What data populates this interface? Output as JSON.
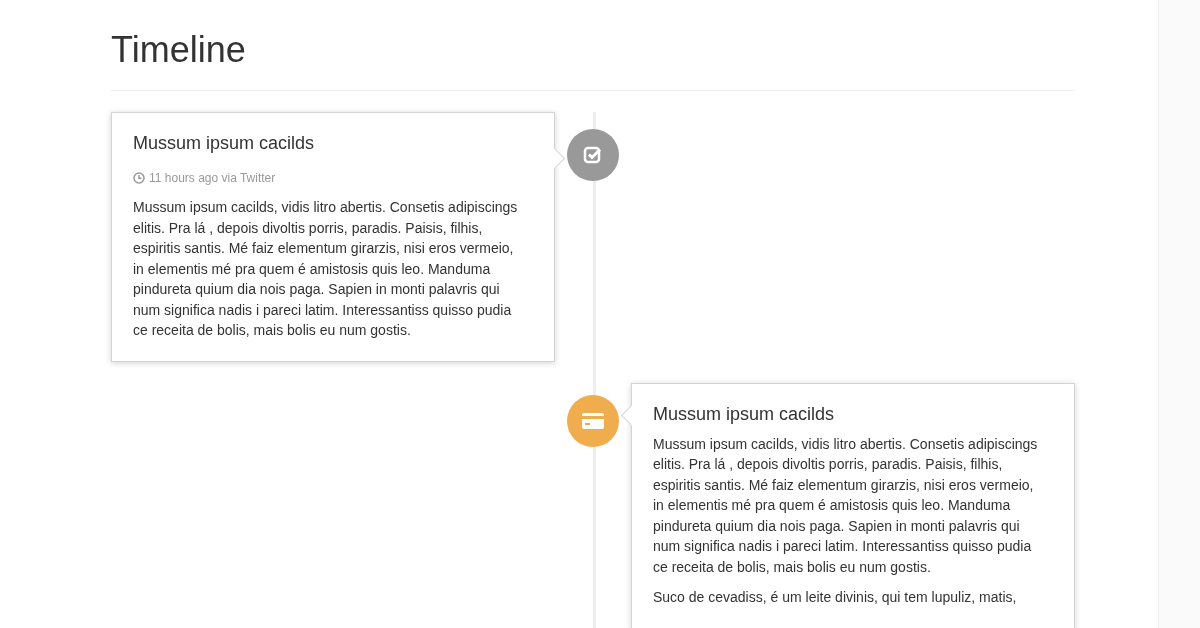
{
  "page": {
    "title": "Timeline"
  },
  "timeline": [
    {
      "kind": "check",
      "color": "#999999",
      "title": "Mussum ipsum cacilds",
      "meta": "11 hours ago via Twitter",
      "paragraphs": [
        "Mussum ipsum cacilds, vidis litro abertis. Consetis adipiscings elitis. Pra lá , depois divoltis porris, paradis. Paisis, filhis, espiritis santis. Mé faiz elementum girarzis, nisi eros vermeio, in elementis mé pra quem é amistosis quis leo. Manduma pindureta quium dia nois paga. Sapien in monti palavris qui num significa nadis i pareci latim. Interessantiss quisso pudia ce receita de bolis, mais bolis eu num gostis."
      ]
    },
    {
      "kind": "card",
      "color": "#f0ad4e",
      "title": "Mussum ipsum cacilds",
      "paragraphs": [
        "Mussum ipsum cacilds, vidis litro abertis. Consetis adipiscings elitis. Pra lá , depois divoltis porris, paradis. Paisis, filhis, espiritis santis. Mé faiz elementum girarzis, nisi eros vermeio, in elementis mé pra quem é amistosis quis leo. Manduma pindureta quium dia nois paga. Sapien in monti palavris qui num significa nadis i pareci latim. Interessantiss quisso pudia ce receita de bolis, mais bolis eu num gostis.",
        "Suco de cevadiss, é um leite divinis, qui tem lupuliz, matis,"
      ]
    }
  ]
}
